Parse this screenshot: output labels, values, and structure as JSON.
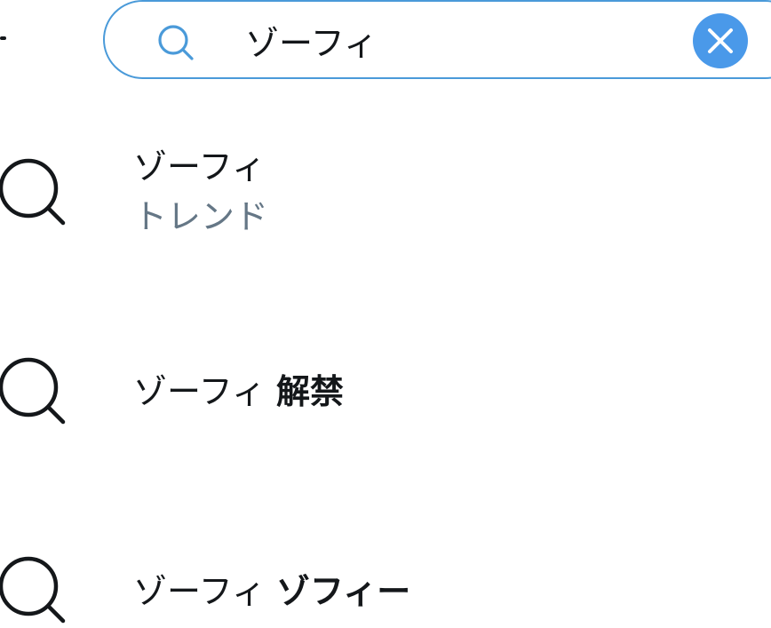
{
  "search": {
    "value": "ゾーフィ",
    "clear_icon": "close-icon",
    "search_icon": "search-icon"
  },
  "suggestions": [
    {
      "query": "ゾーフィ",
      "completion": "",
      "subtitle": "トレンド"
    },
    {
      "query": "ゾーフィ ",
      "completion": "解禁"
    },
    {
      "query": "ゾーフィ ",
      "completion": "ゾフィー"
    }
  ],
  "colors": {
    "accent": "#4a99e9",
    "text": "#14171a",
    "secondary_text": "#657786"
  }
}
